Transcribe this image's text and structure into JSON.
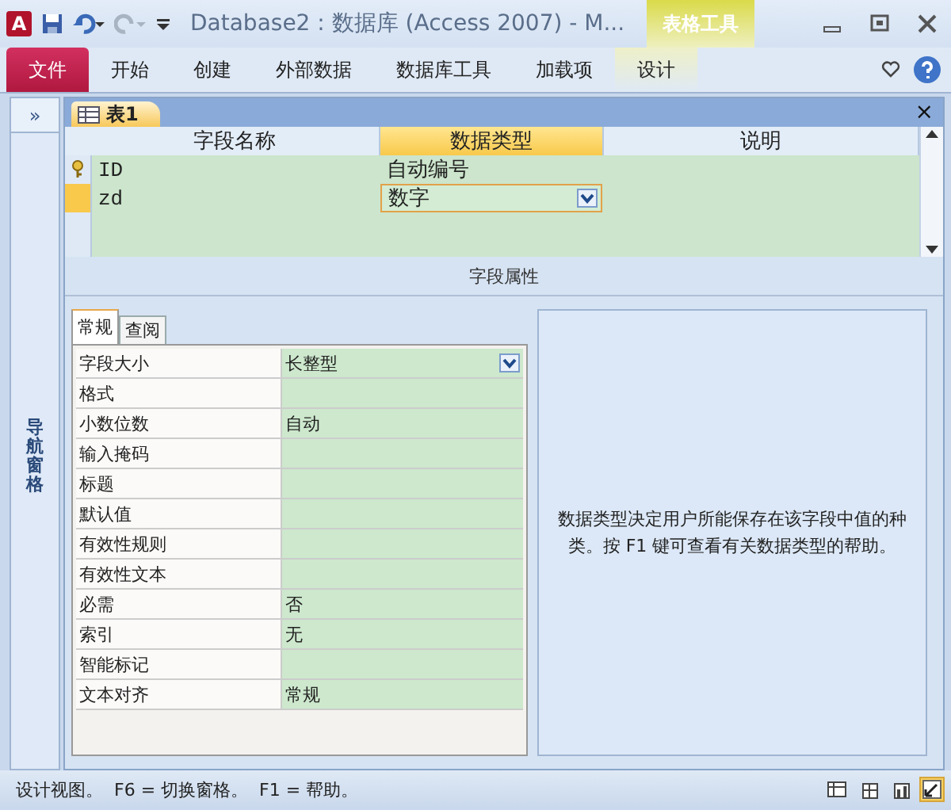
{
  "title_bar": {
    "app_icon": "A",
    "title": "Database2 : 数据库 (Access 2007)  -  M...",
    "context_label": "表格工具"
  },
  "ribbon_tabs": [
    {
      "label": "文件",
      "kind": "file"
    },
    {
      "label": "开始",
      "kind": "normal"
    },
    {
      "label": "创建",
      "kind": "normal"
    },
    {
      "label": "外部数据",
      "kind": "normal"
    },
    {
      "label": "数据库工具",
      "kind": "normal"
    },
    {
      "label": "加载项",
      "kind": "normal"
    },
    {
      "label": "设计",
      "kind": "context"
    }
  ],
  "nav_pane": {
    "toggle": "»",
    "label": "导航窗格"
  },
  "document_tab": {
    "label": "表1",
    "close": "×"
  },
  "field_grid": {
    "columns": [
      {
        "label": "字段名称",
        "selected": false
      },
      {
        "label": "数据类型",
        "selected": true
      },
      {
        "label": "说明",
        "selected": false
      }
    ],
    "rows": [
      {
        "primary_key": true,
        "selected": false,
        "name": "ID",
        "type": "自动编号"
      },
      {
        "primary_key": false,
        "selected": true,
        "name": "zd",
        "type": "数字"
      }
    ]
  },
  "properties_title": "字段属性",
  "property_tabs": [
    {
      "label": "常规",
      "selected": true
    },
    {
      "label": "查阅",
      "selected": false
    }
  ],
  "properties": [
    {
      "label": "字段大小",
      "value": "长整型",
      "dropdown": true
    },
    {
      "label": "格式",
      "dropdown": false
    },
    {
      "label": "小数位数",
      "value": "自动",
      "dropdown": false
    },
    {
      "label": "输入掩码",
      "dropdown": false
    },
    {
      "label": "标题",
      "dropdown": false
    },
    {
      "label": "默认值",
      "dropdown": false
    },
    {
      "label": "有效性规则",
      "dropdown": false
    },
    {
      "label": "有效性文本",
      "dropdown": false
    },
    {
      "label": "必需",
      "value": "否",
      "dropdown": false
    },
    {
      "label": "索引",
      "value": "无",
      "dropdown": false
    },
    {
      "label": "智能标记",
      "dropdown": false
    },
    {
      "label": "文本对齐",
      "value": "常规",
      "dropdown": false
    }
  ],
  "help_text": "数据类型决定用户所能保存在该字段中值的种类。按 F1 键可查看有关数据类型的帮助。",
  "status_bar": {
    "text": "设计视图。  F6 = 切换窗格。  F1 = 帮助。",
    "views": [
      {
        "selected": false
      },
      {
        "selected": false
      },
      {
        "selected": false
      },
      {
        "selected": true
      }
    ]
  }
}
